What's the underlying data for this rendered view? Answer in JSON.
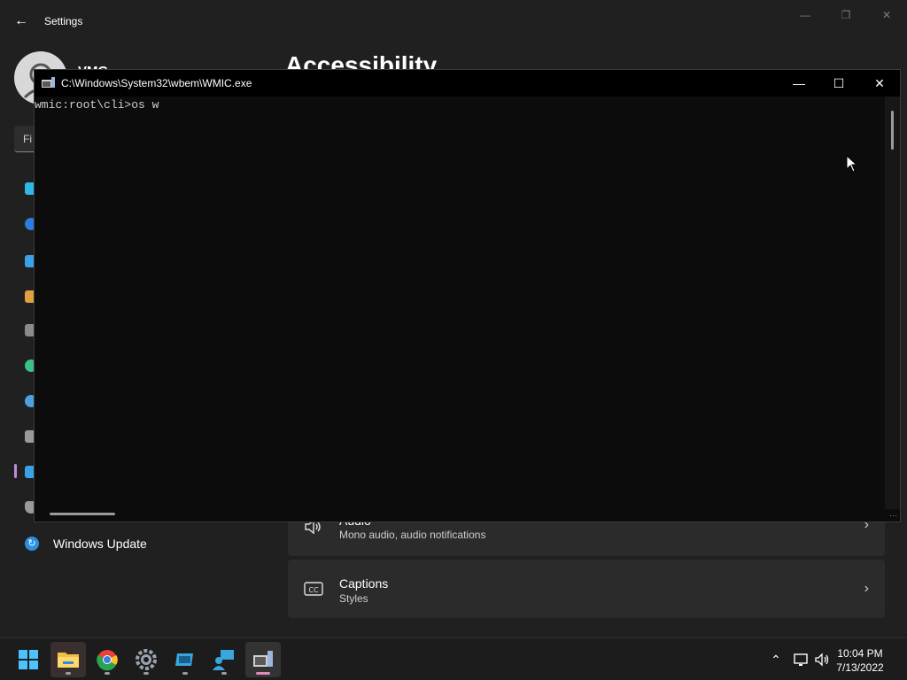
{
  "settings": {
    "title": "Settings",
    "user_name": "VMG",
    "page_heading": "Accessibility",
    "search_placeholder": "Fi",
    "nav_windows_update": "Windows Update",
    "cards": [
      {
        "title": "Audio",
        "subtitle": "Mono audio, audio notifications",
        "icon": "speaker-icon"
      },
      {
        "title": "Captions",
        "subtitle": "Styles",
        "icon": "captions-icon"
      }
    ]
  },
  "console": {
    "title": "C:\\Windows\\System32\\wbem\\WMIC.exe",
    "prompt_line": "wmic:root\\cli>os w"
  },
  "taskbar": {
    "time": "10:04 PM",
    "date": "7/13/2022"
  },
  "colors": {
    "accent": "#c08ae0",
    "console_bg": "#0c0c0c",
    "settings_bg": "#202020"
  }
}
